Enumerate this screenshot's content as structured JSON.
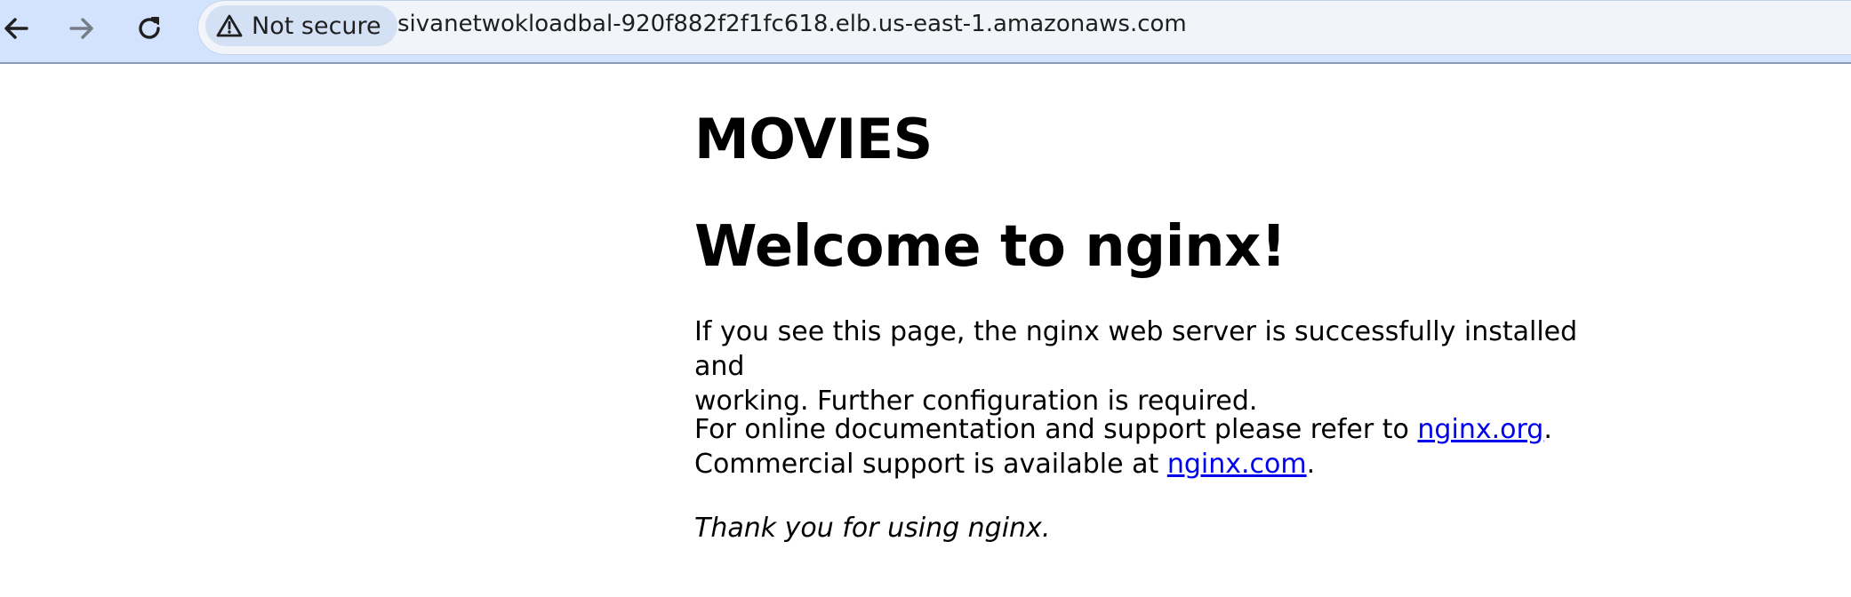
{
  "browser": {
    "back_icon": "arrow-left-icon",
    "forward_icon": "arrow-right-icon",
    "reload_icon": "reload-icon",
    "security": {
      "icon": "warning-triangle-icon",
      "label": "Not secure"
    },
    "url": "sivanetwokloadbal-920f882f2f1fc618.elb.us-east-1.amazonaws.com",
    "colors": {
      "toolbar_bg": "#d3e3fd",
      "omnibox_bg": "#f1f4f9",
      "chip_bg": "#d4e1f5"
    }
  },
  "page": {
    "heading_primary": "MOVIES",
    "heading_secondary": "Welcome to nginx!",
    "paragraph1": {
      "line1": "If you see this page, the nginx web server is successfully installed and",
      "line2": "working. Further configuration is required."
    },
    "paragraph2": {
      "prefix": "For online documentation and support please refer to ",
      "link1_text": "nginx.org",
      "middle": ".",
      "line2_prefix": "Commercial support is available at ",
      "link2_text": "nginx.com",
      "suffix": "."
    },
    "paragraph3": "Thank you for using nginx.",
    "colors": {
      "link": "#0000ee",
      "text": "#000000"
    }
  }
}
